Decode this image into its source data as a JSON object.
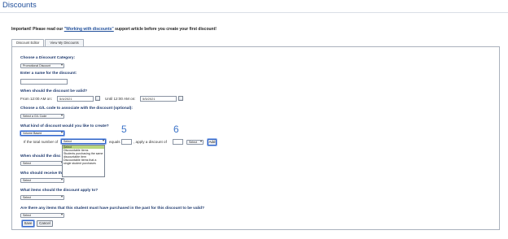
{
  "page": {
    "title": "Discounts"
  },
  "notice": {
    "prefix": "Important! Please read our ",
    "link": "\"Working with discounts\"",
    "suffix": " support article before you create your first discount!"
  },
  "tabs": [
    {
      "label": "Discount Editor",
      "active": true
    },
    {
      "label": "View My Discounts",
      "active": false
    }
  ],
  "form": {
    "category": {
      "label": "Choose a Discount Category:",
      "value": "Promotional Discount"
    },
    "name": {
      "label": "Enter a name for the discount:",
      "value": ""
    },
    "validity": {
      "label": "When should the discount be valid?",
      "from_label": "From 12:00 AM on:",
      "from_value": "5/4/2021",
      "until_label": "Until 12:00 AM on:",
      "until_value": "5/5/2021"
    },
    "gl": {
      "label": "Choose a G/L code to associate with the discount (optional):",
      "value": "Select a G/L Code"
    },
    "kind": {
      "label": "What kind of discount would you like to create?",
      "value": "Volume Based"
    },
    "rule": {
      "if_label": "If the total number of",
      "select_value": "Select",
      "equals_label": "equals",
      "apply_label": ", apply a discount of",
      "unit_value": "Select",
      "add_label": "Add"
    },
    "dropdown_options": [
      "Select",
      "Discountable items",
      "Students purchasing the same discountable item",
      "Discountable items that a single student purchases"
    ],
    "dropdown_selected_index": 0,
    "when_apply": {
      "label": "When should the disc",
      "value": "Select"
    },
    "who_receive": {
      "label": "Who should receive th",
      "value": "Select"
    },
    "items_apply": {
      "label": "What items should the discount apply to?",
      "value": "Select"
    },
    "prior_purchase": {
      "label": "Are there any items that this student must have purchased in the past for this discount to be valid?",
      "value": "Select"
    }
  },
  "annotations": {
    "step_a": "5",
    "step_b": "6"
  },
  "buttons": {
    "save": "Save",
    "cancel": "Cancel"
  }
}
